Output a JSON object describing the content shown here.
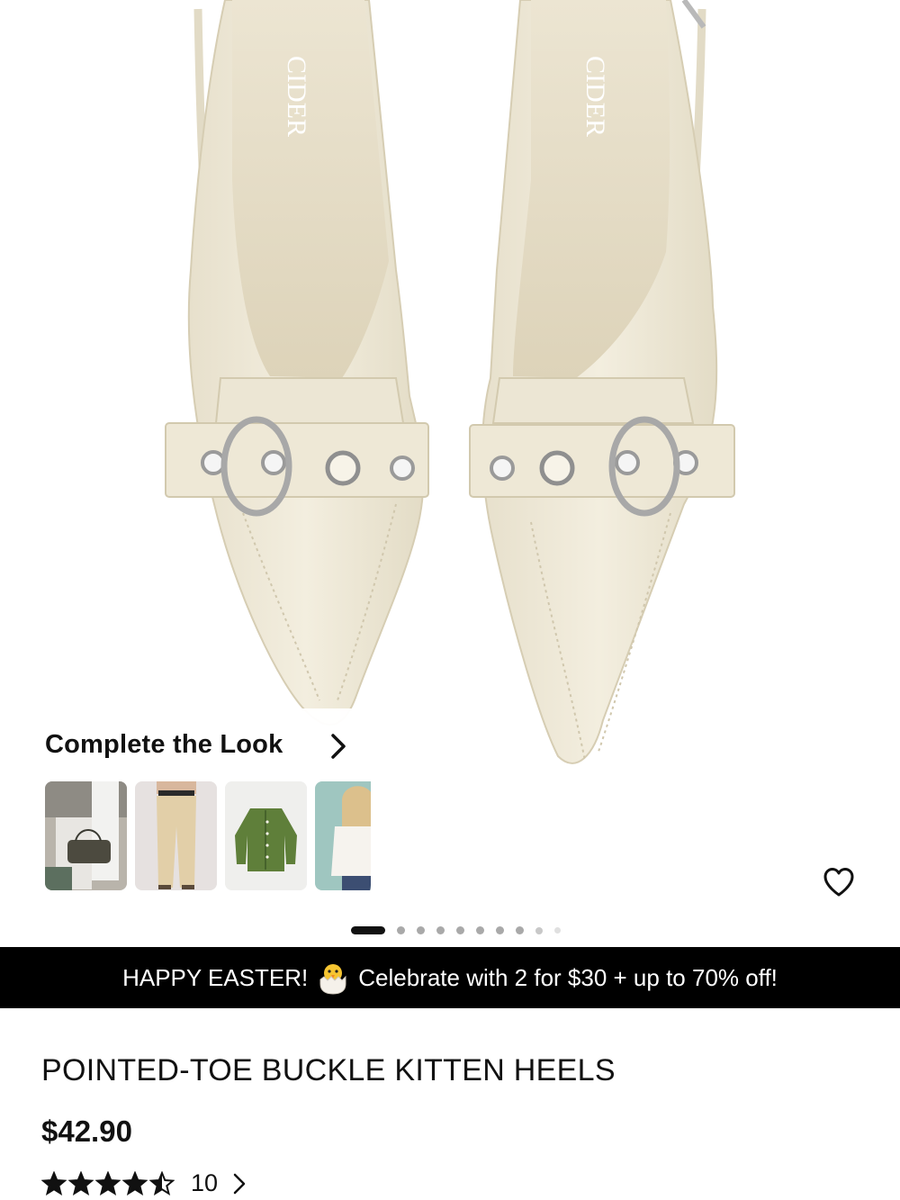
{
  "product_image": {
    "brand_text": "CIDER"
  },
  "complete_look": {
    "title": "Complete the Look",
    "thumbnails": [
      {
        "name": "street-bag-look"
      },
      {
        "name": "beige-trousers"
      },
      {
        "name": "green-cardigan"
      },
      {
        "name": "white-knit-cardigan"
      }
    ]
  },
  "carousel": {
    "total": 10,
    "active_index": 0
  },
  "promo_banner": {
    "text_left": "HAPPY EASTER!",
    "icon": "hatching-chick-icon",
    "text_right": "Celebrate with 2 for $30 + up to 70% off!"
  },
  "product": {
    "title": "POINTED-TOE BUCKLE KITTEN HEELS",
    "price": "$42.90",
    "rating_value": 4.5,
    "rating_count": "10"
  },
  "colors": {
    "shoe": "#efe9d8",
    "banner_bg": "#000000",
    "text": "#111111"
  }
}
